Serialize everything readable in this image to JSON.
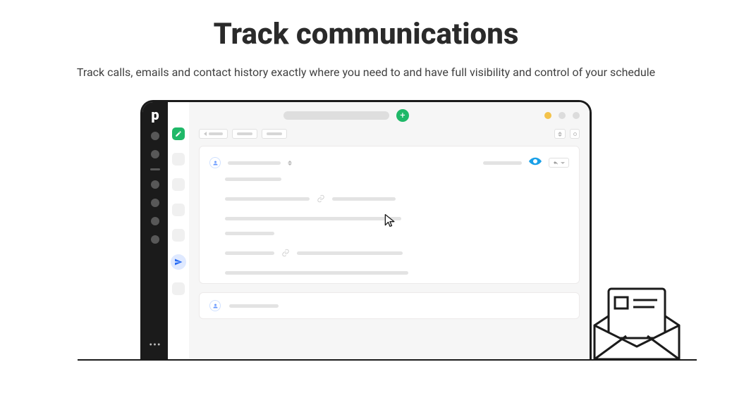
{
  "hero": {
    "title": "Track communications",
    "subtitle": "Track calls, emails and contact history exactly where you need to and have full visibility and control of your schedule"
  },
  "logo_letter": "p",
  "plus_label": "+"
}
